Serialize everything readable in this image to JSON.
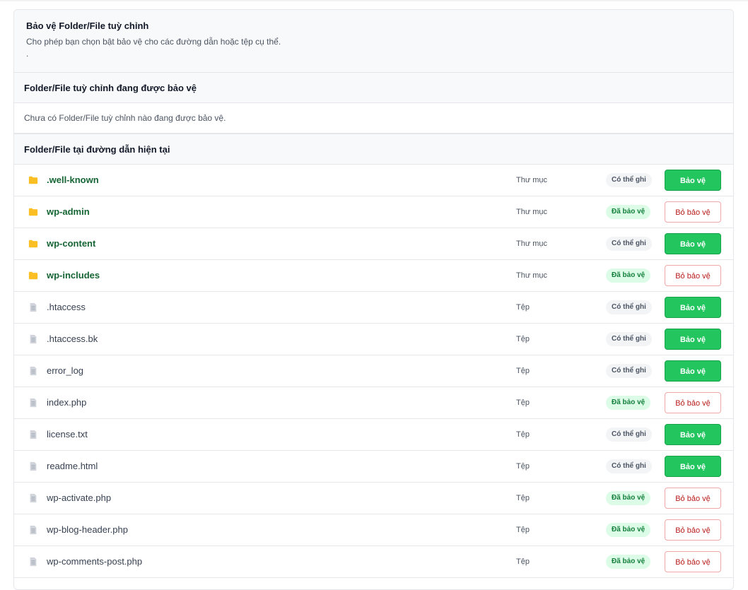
{
  "header": {
    "title": "Bảo vệ Folder/File tuỳ chỉnh",
    "description": "Cho phép bạn chọn bật bảo vệ cho các đường dẫn hoặc tệp cụ thể.",
    "dot": "."
  },
  "custom_section": {
    "title": "Folder/File tuỳ chỉnh đang được bảo vệ",
    "empty_text": "Chưa có Folder/File tuỳ chỉnh nào đang được bảo vệ."
  },
  "current_section": {
    "title": "Folder/File tại đường dẫn hiện tại"
  },
  "colors": {
    "folder_icon": "#fbbf24",
    "file_icon": "#d1d5db",
    "protect_button": "#22c55e",
    "unprotect_border": "#f0a8a8"
  },
  "items": [
    {
      "name": ".well-known",
      "kind": "folder",
      "type": "Thư mục",
      "status": "Có thể ghi",
      "status_key": "writable",
      "action": "Bảo vệ",
      "action_key": "protect"
    },
    {
      "name": "wp-admin",
      "kind": "folder",
      "type": "Thư mục",
      "status": "Đã bảo vệ",
      "status_key": "protected",
      "action": "Bỏ bảo vệ",
      "action_key": "unprotect"
    },
    {
      "name": "wp-content",
      "kind": "folder",
      "type": "Thư mục",
      "status": "Có thể ghi",
      "status_key": "writable",
      "action": "Bảo vệ",
      "action_key": "protect"
    },
    {
      "name": "wp-includes",
      "kind": "folder",
      "type": "Thư mục",
      "status": "Đã bảo vệ",
      "status_key": "protected",
      "action": "Bỏ bảo vệ",
      "action_key": "unprotect"
    },
    {
      "name": ".htaccess",
      "kind": "file",
      "type": "Tệp",
      "status": "Có thể ghi",
      "status_key": "writable",
      "action": "Bảo vệ",
      "action_key": "protect"
    },
    {
      "name": ".htaccess.bk",
      "kind": "file",
      "type": "Tệp",
      "status": "Có thể ghi",
      "status_key": "writable",
      "action": "Bảo vệ",
      "action_key": "protect"
    },
    {
      "name": "error_log",
      "kind": "file",
      "type": "Tệp",
      "status": "Có thể ghi",
      "status_key": "writable",
      "action": "Bảo vệ",
      "action_key": "protect"
    },
    {
      "name": "index.php",
      "kind": "file",
      "type": "Tệp",
      "status": "Đã bảo vệ",
      "status_key": "protected",
      "action": "Bỏ bảo vệ",
      "action_key": "unprotect"
    },
    {
      "name": "license.txt",
      "kind": "file",
      "type": "Tệp",
      "status": "Có thể ghi",
      "status_key": "writable",
      "action": "Bảo vệ",
      "action_key": "protect"
    },
    {
      "name": "readme.html",
      "kind": "file",
      "type": "Tệp",
      "status": "Có thể ghi",
      "status_key": "writable",
      "action": "Bảo vệ",
      "action_key": "protect"
    },
    {
      "name": "wp-activate.php",
      "kind": "file",
      "type": "Tệp",
      "status": "Đã bảo vệ",
      "status_key": "protected",
      "action": "Bỏ bảo vệ",
      "action_key": "unprotect"
    },
    {
      "name": "wp-blog-header.php",
      "kind": "file",
      "type": "Tệp",
      "status": "Đã bảo vệ",
      "status_key": "protected",
      "action": "Bỏ bảo vệ",
      "action_key": "unprotect"
    },
    {
      "name": "wp-comments-post.php",
      "kind": "file",
      "type": "Tệp",
      "status": "Đã bảo vệ",
      "status_key": "protected",
      "action": "Bỏ bảo vệ",
      "action_key": "unprotect"
    }
  ]
}
